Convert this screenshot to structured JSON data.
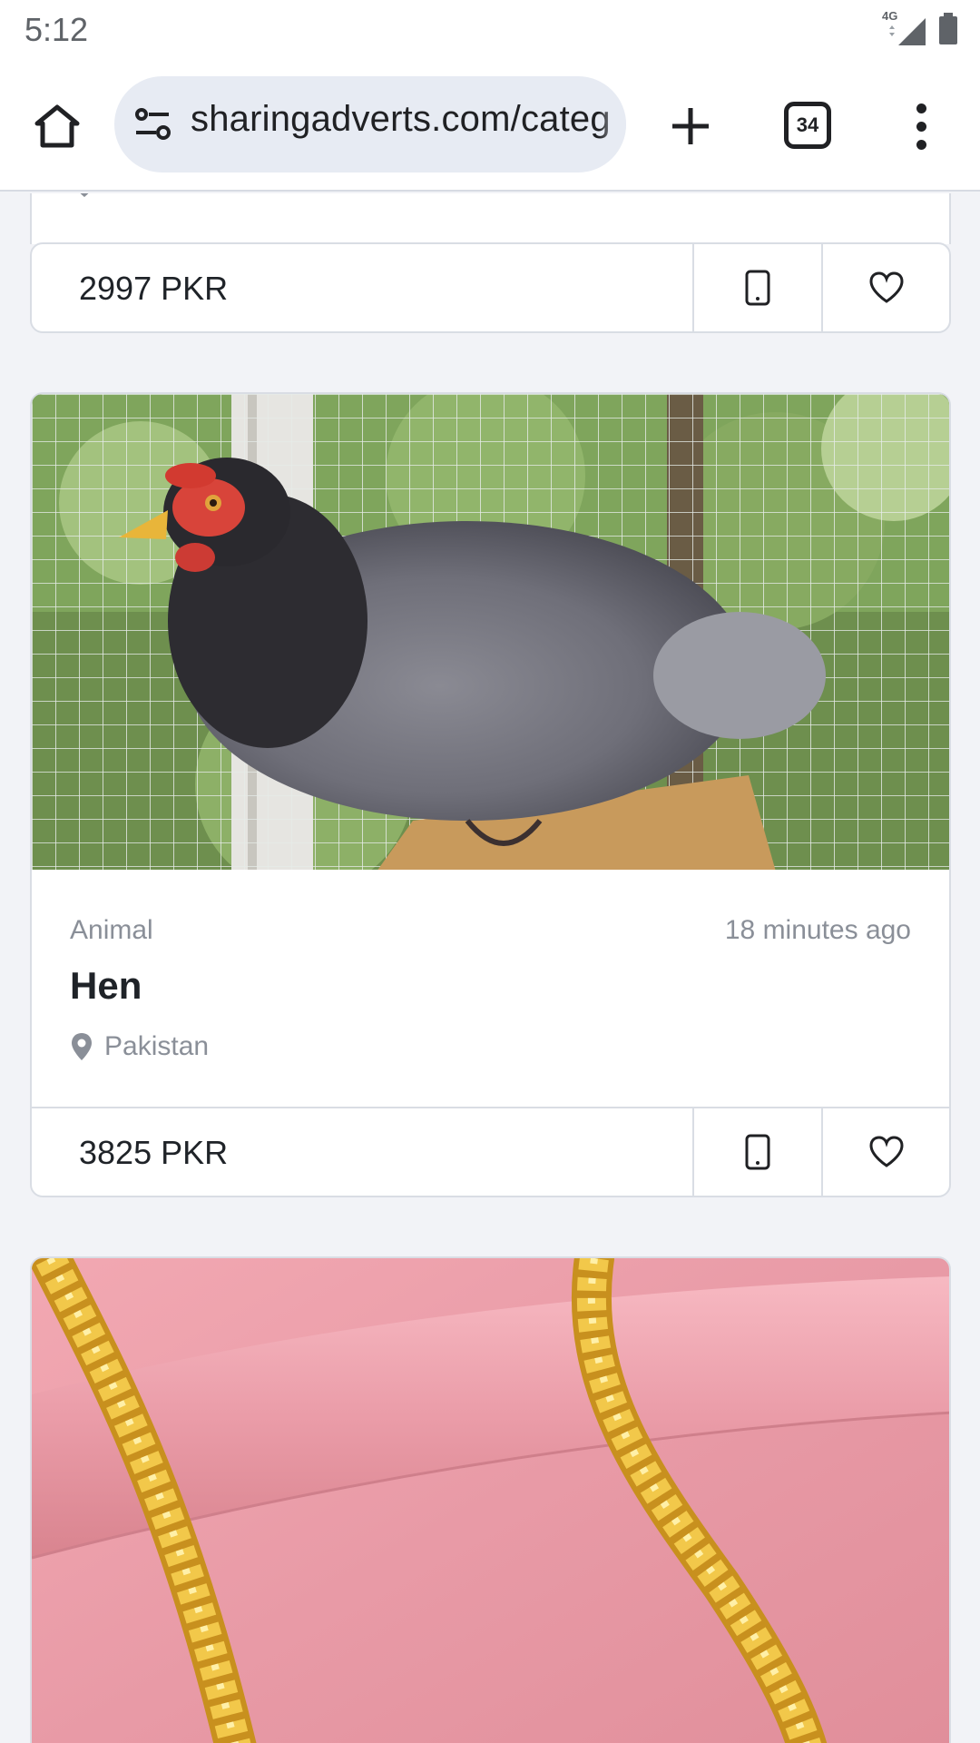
{
  "status_bar": {
    "time": "5:12",
    "network": "4G"
  },
  "browser": {
    "url": "sharingadverts.com/categ",
    "tab_count": "34"
  },
  "listings": [
    {
      "price": "2997 PKR"
    },
    {
      "category": "Animal",
      "time_ago": "18 minutes ago",
      "title": "Hen",
      "location": "Pakistan",
      "price": "3825 PKR",
      "image": "hen-photo"
    },
    {
      "image": "gold-chain-photo"
    }
  ],
  "colors": {
    "page_bg": "#f2f3f7",
    "card_border": "#d9dde4",
    "url_pill": "#e7ebf3",
    "muted_text": "#8a8f98"
  }
}
